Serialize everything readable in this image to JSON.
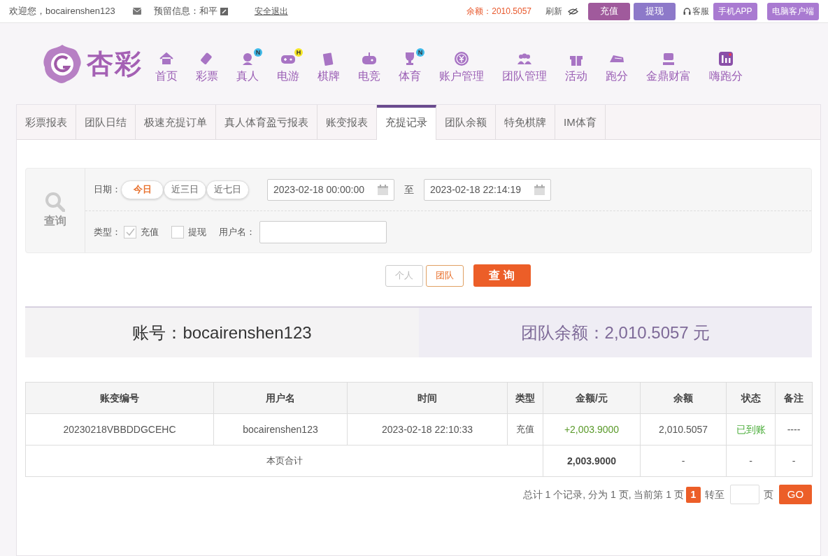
{
  "top_bar": {
    "welcome": "欢迎您，bocairenshen123",
    "reserved_info": "预留信息：和平",
    "logout": "安全退出",
    "balance": "余额：2010.5057",
    "refresh": "刷新",
    "buttons": [
      {
        "label": "充值",
        "kind": "deposit"
      },
      {
        "label": "提现",
        "kind": "withdraw"
      }
    ],
    "service": "客服",
    "app_buttons": [
      "手机APP",
      "电脑客户端"
    ]
  },
  "logo": {
    "text": "杏彩"
  },
  "nav": [
    {
      "label": "首页"
    },
    {
      "label": "彩票"
    },
    {
      "label": "真人",
      "badge": "N",
      "color": "#3fb9e8"
    },
    {
      "label": "电游",
      "badge": "H",
      "color": "#f5e625"
    },
    {
      "label": "棋牌"
    },
    {
      "label": "电竞"
    },
    {
      "label": "体育",
      "badge": "N",
      "color": "#3fb9e8"
    },
    {
      "label": "账户管理"
    },
    {
      "label": "团队管理"
    },
    {
      "label": "活动"
    },
    {
      "label": "跑分"
    },
    {
      "label": "金鼎财富"
    },
    {
      "label": "嗨跑分"
    }
  ],
  "tabs": [
    {
      "label": "彩票报表",
      "selected": false
    },
    {
      "label": "团队日结",
      "selected": false
    },
    {
      "label": "极速充提订单",
      "selected": false
    },
    {
      "label": "真人体育盈亏报表",
      "selected": false
    },
    {
      "label": "账变报表",
      "selected": false
    },
    {
      "label": "充提记录",
      "selected": true
    },
    {
      "label": "团队余额",
      "selected": false
    },
    {
      "label": "特免棋牌",
      "selected": false
    },
    {
      "label": "IM体育",
      "selected": false
    }
  ],
  "filter": {
    "search_label": "查询",
    "date_label": "日期：",
    "date_presets": [
      {
        "label": "今日",
        "selected": true
      },
      {
        "label": "近三日",
        "selected": false
      },
      {
        "label": "近七日",
        "selected": false
      }
    ],
    "date_from": "2023-02-18 00:00:00",
    "to_label": "至",
    "date_to": "2023-02-18 22:14:19",
    "type_label": "类型：",
    "types": [
      {
        "label": "充值",
        "checked": true
      },
      {
        "label": "提现",
        "checked": false
      }
    ],
    "username_label": "用户名："
  },
  "scope": [
    {
      "label": "个人",
      "selected": false
    },
    {
      "label": "团队",
      "selected": true
    }
  ],
  "query_button": "查 询",
  "summary": {
    "account": "账号：bocairenshen123",
    "team_balance": "团队余额：2,010.5057 元"
  },
  "table": {
    "columns": [
      "账变编号",
      "用户名",
      "时间",
      "类型",
      "金额/元",
      "余额",
      "状态",
      "备注"
    ],
    "rows": [
      [
        "20230218VBBDDGCEHC",
        "bocairenshen123",
        "2023-02-18 22:10:33",
        "充值",
        "+2,003.9000",
        "2,010.5057",
        "已到账",
        "----"
      ]
    ],
    "total": {
      "label": "本页合计",
      "amount": "2,003.9000",
      "balance": "-",
      "status": "-",
      "note": "-"
    }
  },
  "pagination": {
    "summary": "总计 1 个记录, 分为 1 页, 当前第 1 页",
    "current": "1",
    "goto_label": "转至",
    "page_label": "页",
    "go": "GO"
  }
}
